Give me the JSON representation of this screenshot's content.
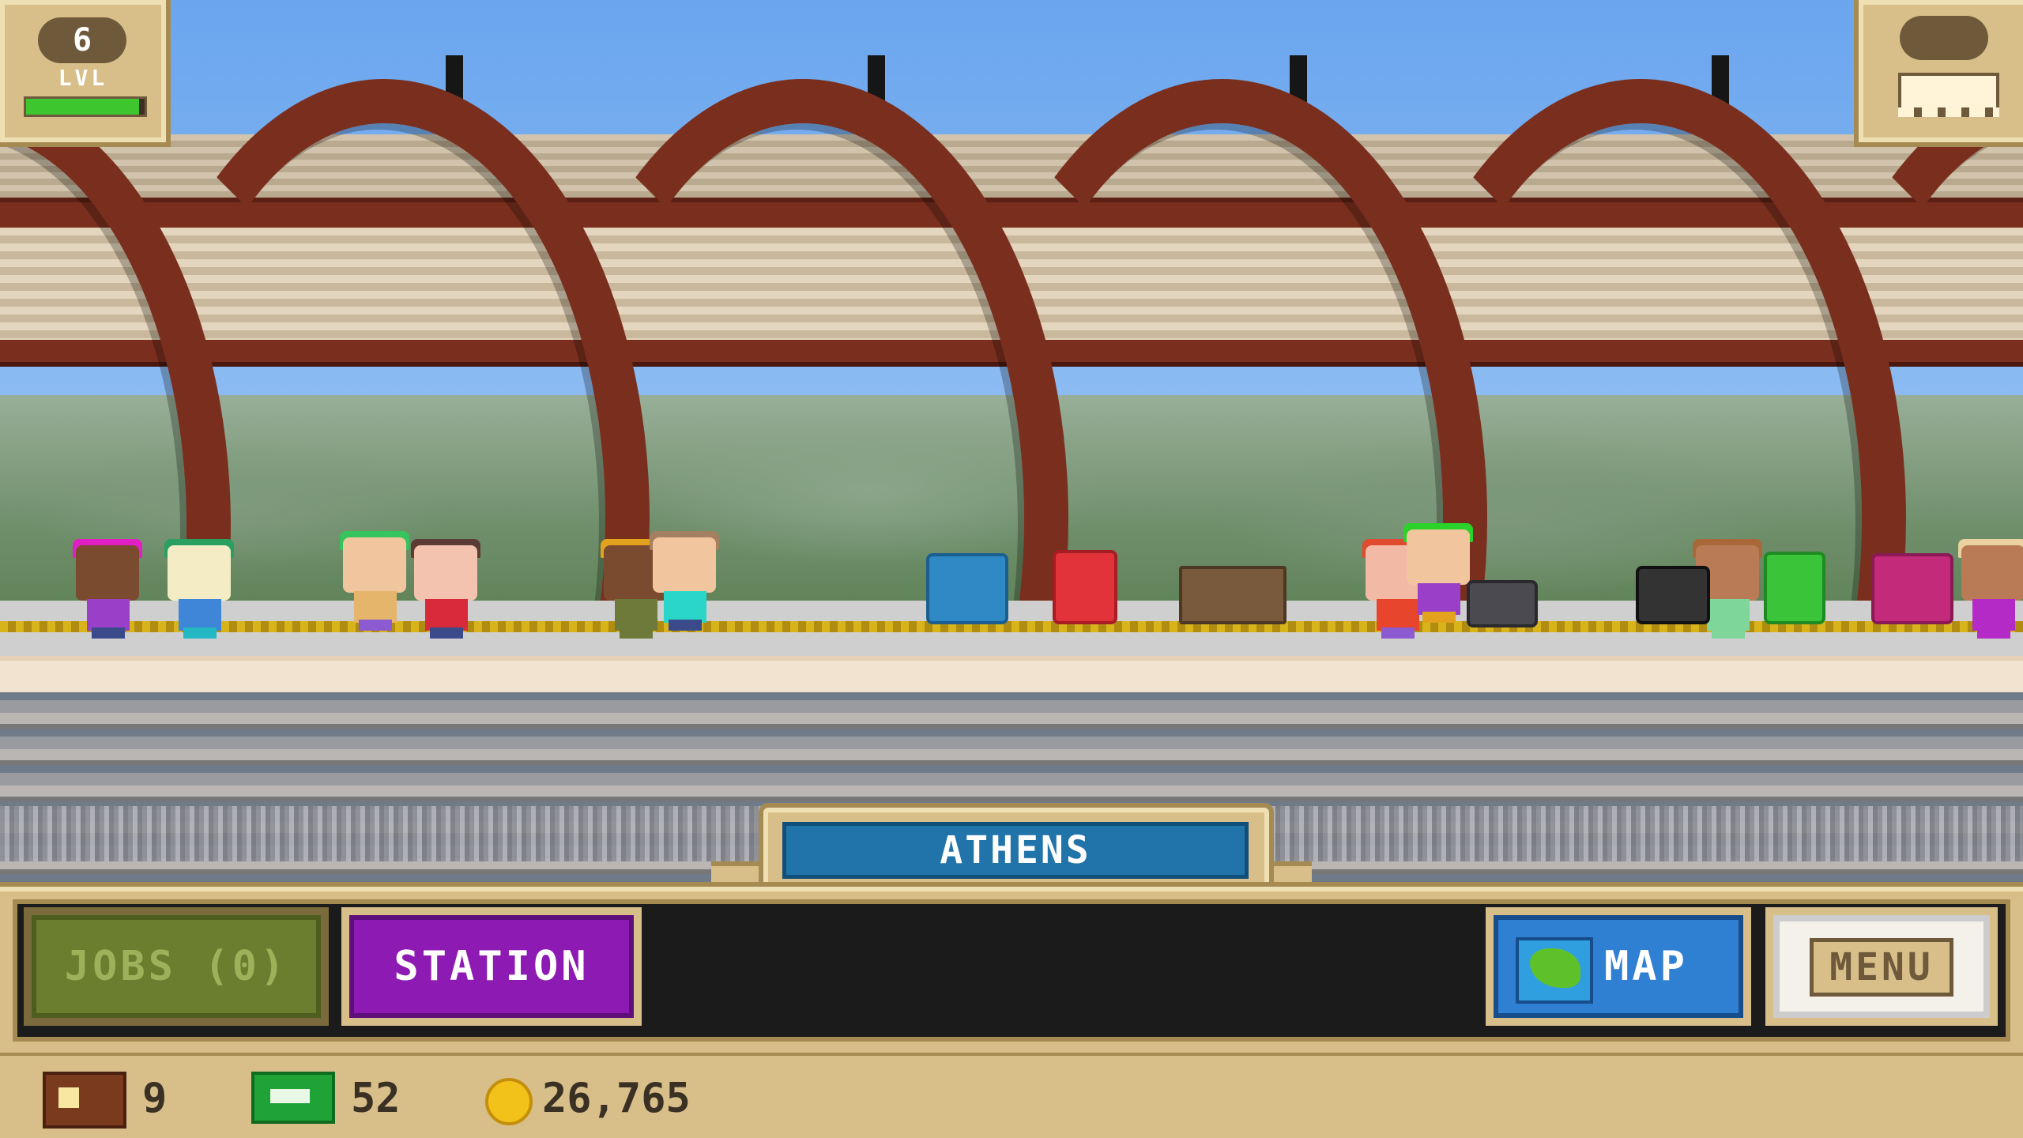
{
  "hud": {
    "level_value": "6",
    "level_label": "LVL",
    "level_progress": 0.95
  },
  "city": {
    "name": "ATHENS"
  },
  "buttons": {
    "jobs_label": "JOBS (0)",
    "station_label": "STATION",
    "map_label": "MAP",
    "menu_label": "MENU"
  },
  "resources": {
    "tickets": "9",
    "cash": "52",
    "coins": "26,765"
  },
  "icons": [
    "train-icon",
    "ticket-icon",
    "cash-icon",
    "coin-icon",
    "map-icon"
  ],
  "colors": {
    "station_purple": "#8c1ab3",
    "map_blue": "#2f7fd3",
    "jobs_green": "#6b7d2e",
    "city_blue": "#2174a9",
    "ui_tan": "#d8bf8a"
  }
}
